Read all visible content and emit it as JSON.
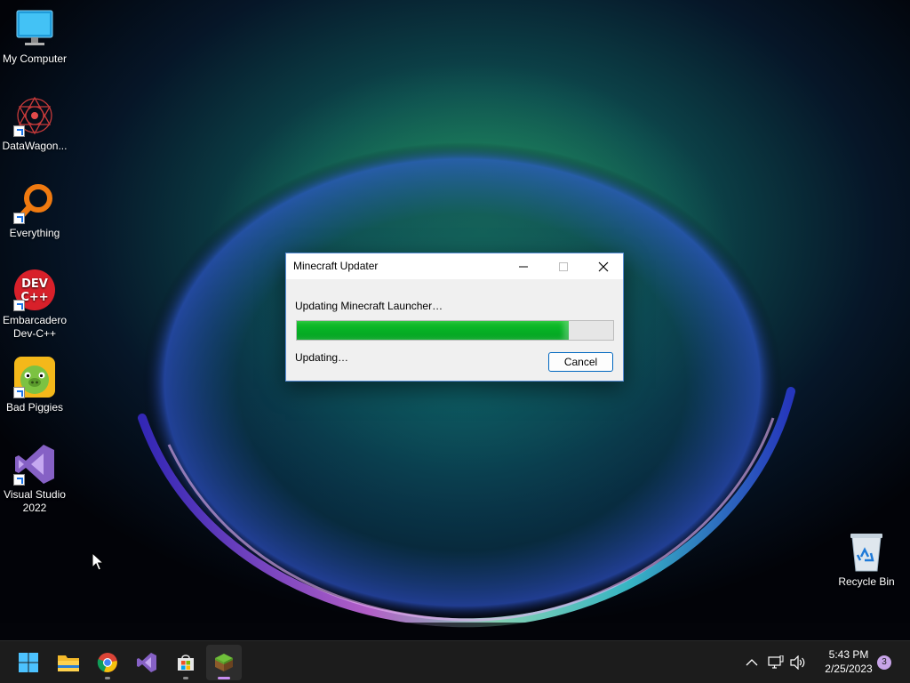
{
  "desktop": {
    "icons": [
      {
        "label": "My Computer",
        "icon": "computer-icon"
      },
      {
        "label": "DataWagon...",
        "icon": "datawagon-icon"
      },
      {
        "label": "Everything",
        "icon": "everything-search-icon"
      },
      {
        "label": "Embarcadero Dev-C++",
        "icon": "devcpp-icon",
        "badge": "DEV C++"
      },
      {
        "label": "Bad Piggies",
        "icon": "bad-piggies-icon"
      },
      {
        "label": "Visual Studio 2022",
        "icon": "visual-studio-icon"
      },
      {
        "label": "Recycle Bin",
        "icon": "recycle-bin-icon"
      }
    ]
  },
  "dialog": {
    "title": "Minecraft Updater",
    "message": "Updating Minecraft Launcher…",
    "progress_percent": 86,
    "status": "Updating…",
    "cancel_label": "Cancel",
    "progress_color": "#06b025"
  },
  "taskbar": {
    "apps": [
      {
        "name": "start-icon"
      },
      {
        "name": "file-explorer-icon"
      },
      {
        "name": "chrome-icon"
      },
      {
        "name": "visual-studio-icon"
      },
      {
        "name": "microsoft-store-icon"
      },
      {
        "name": "minecraft-icon",
        "active": true
      }
    ],
    "time": "5:43 PM",
    "date": "2/25/2023",
    "notification_count": "3"
  }
}
